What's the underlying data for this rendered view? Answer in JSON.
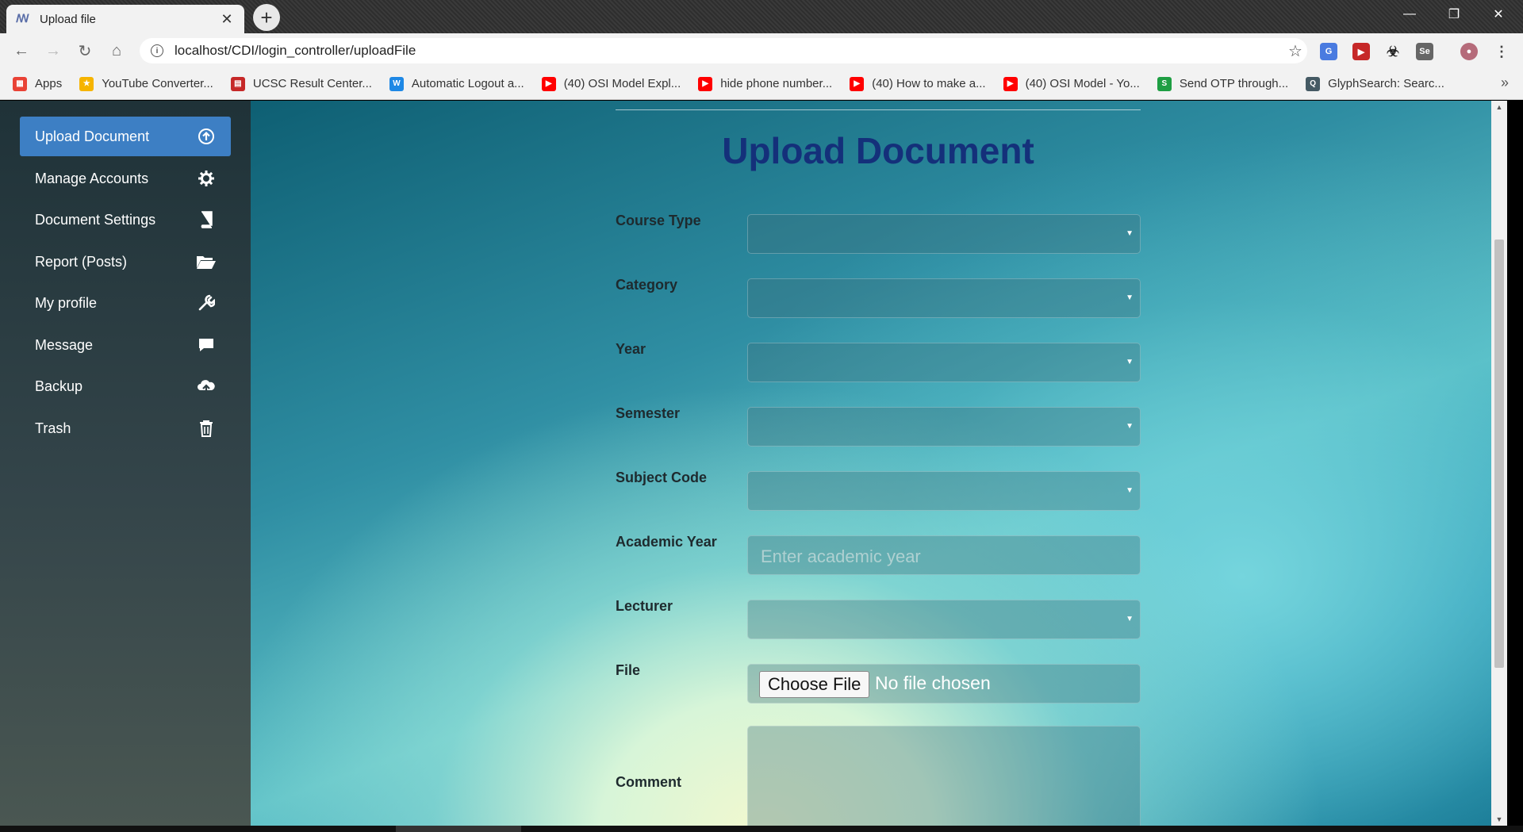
{
  "browser": {
    "tab_title": "Upload file",
    "url": "localhost/CDI/login_controller/uploadFile",
    "bookmarks": [
      {
        "label": "Apps",
        "icon": "apps-grid-icon",
        "color": "#e94235"
      },
      {
        "label": "YouTube Converter...",
        "icon": "youtube-converter-icon",
        "color": "#f6b400"
      },
      {
        "label": "UCSC Result Center...",
        "icon": "document-icon",
        "color": "#c62828"
      },
      {
        "label": "Automatic Logout a...",
        "icon": "w-icon",
        "color": "#1e88e5"
      },
      {
        "label": "(40) OSI Model Expl...",
        "icon": "youtube-icon",
        "color": "#ff0000"
      },
      {
        "label": "hide phone number...",
        "icon": "youtube-icon",
        "color": "#ff0000"
      },
      {
        "label": "(40) How to make a...",
        "icon": "youtube-icon",
        "color": "#ff0000"
      },
      {
        "label": "(40) OSI Model - Yo...",
        "icon": "youtube-icon",
        "color": "#ff0000"
      },
      {
        "label": "Send OTP through...",
        "icon": "s-icon",
        "color": "#1e9e43"
      },
      {
        "label": "GlyphSearch: Searc...",
        "icon": "glyphsearch-icon",
        "color": "#455a64"
      }
    ]
  },
  "sidebar": {
    "items": [
      {
        "label": "Upload Document",
        "icon": "upload-icon",
        "active": true
      },
      {
        "label": "Manage Accounts",
        "icon": "gear-icon",
        "active": false
      },
      {
        "label": "Document Settings",
        "icon": "book-icon",
        "active": false
      },
      {
        "label": "Report (Posts)",
        "icon": "folder-open-icon",
        "active": false
      },
      {
        "label": "My profile",
        "icon": "wrench-icon",
        "active": false
      },
      {
        "label": "Message",
        "icon": "chat-icon",
        "active": false
      },
      {
        "label": "Backup",
        "icon": "cloud-upload-icon",
        "active": false
      },
      {
        "label": "Trash",
        "icon": "trash-icon",
        "active": false
      }
    ]
  },
  "form": {
    "title": "Upload Document",
    "fields": {
      "course_type": {
        "label": "Course Type"
      },
      "category": {
        "label": "Category"
      },
      "year": {
        "label": "Year"
      },
      "semester": {
        "label": "Semester"
      },
      "subject_code": {
        "label": "Subject Code"
      },
      "academic_year": {
        "label": "Academic Year",
        "placeholder": "Enter academic year"
      },
      "lecturer": {
        "label": "Lecturer"
      },
      "file": {
        "label": "File",
        "button": "Choose File",
        "status": "No file chosen"
      },
      "comment": {
        "label": "Comment"
      }
    }
  },
  "colors": {
    "accent": "#3d7fc4",
    "title": "#14307a"
  }
}
